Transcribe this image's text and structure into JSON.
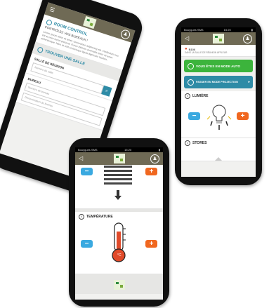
{
  "phone_left": {
    "room_control_title": "ROOM CONTROL",
    "room_control_subtitle": "CONTRÔLEZ VOS BUREAUX !",
    "intro_text": "Lorem ipsum dolor sit amet, consectetur adipiscing elit. Vestibulum nec elit at enim luctus placerat. Fusce lobortis venenatis tortor sit amet pellentesque. Nam at velit scelerisque ligula dignissim facilisis.",
    "find_room_label": "TROUVER UNE SALLE",
    "meeting_room_label": "SALLE DE RÉUNION",
    "meeting_room_placeholder": "Numéro de salle",
    "office_label": "BUREAU",
    "office_field1_placeholder": "Numéro de bureau",
    "office_field2_placeholder": "Dénomination du bureau"
  },
  "phone_right": {
    "status_carrier": "Bouygues SMS",
    "status_time": "15:20",
    "location_title": "B106",
    "location_subtitle": "DANS LA SALLE DE RÉUNION AFFLEUR",
    "auto_mode_button": "VOUS ÊTES EN MODE AUTO",
    "projection_button": "PASSER EN MODE PROJECTION",
    "light_label": "LUMIÈRE",
    "stores_label": "STORES"
  },
  "phone_center": {
    "status_carrier": "Bouygues SMS",
    "status_time": "15:20",
    "temperature_label": "TEMPÉRATURE",
    "thermo_unit": "°C"
  },
  "colors": {
    "topbar": "#6f6a55",
    "minus": "#3aa9e0",
    "plus": "#f0671f",
    "green": "#3cb43c",
    "teal": "#2e8ba6"
  },
  "icons": [
    "menu-icon",
    "user-icon",
    "back-icon",
    "info-icon",
    "search-icon",
    "lightbulb-icon",
    "thermometer-icon",
    "blinds-icon",
    "arrow-down-icon",
    "map-pin-icon",
    "check-icon"
  ]
}
